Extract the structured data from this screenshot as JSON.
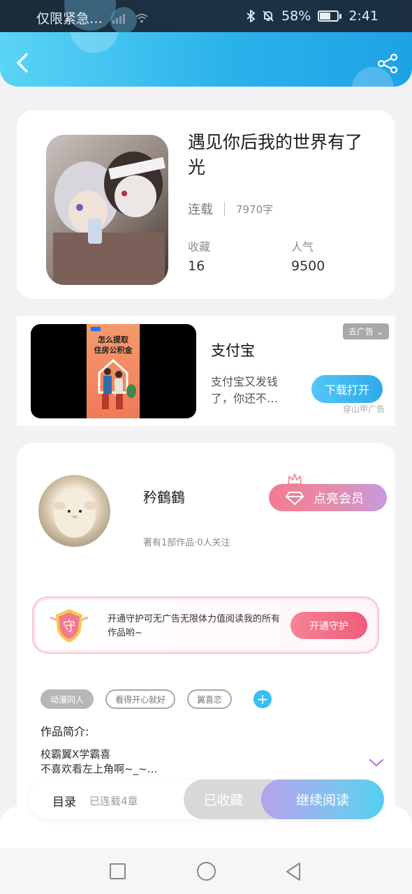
{
  "status_bar": {
    "carrier": "仅限紧急…",
    "battery": "58%",
    "time": "2:41"
  },
  "header": {
    "back_icon": "back-arrow-icon",
    "share_icon": "share-icon"
  },
  "book": {
    "title": "遇见你后我的世界有了光",
    "status": "连载",
    "word_count": "7970字",
    "favorites_label": "收藏",
    "favorites_value": "16",
    "popularity_label": "人气",
    "popularity_value": "9500"
  },
  "ad": {
    "close_label": "去广告",
    "title": "支付宝",
    "description": "支付宝又发钱了，你还不…",
    "button_label": "下载打开",
    "source": "穿山甲广告",
    "poster_text": "怎么提取住房公积金"
  },
  "author": {
    "name": "矜鶴鶴",
    "meta": "著有1部作品·0人关注",
    "vip_button": "点亮会员"
  },
  "guard": {
    "badge": "守",
    "text": "开通守护可无广告无限体力值阅读我的所有作品哟~",
    "button_label": "开通守护"
  },
  "tags": [
    "动漫同人",
    "看得开心就好",
    "翼喜恋"
  ],
  "intro": {
    "label": "作品简介:",
    "line1": "校霸翼X学霸喜",
    "line2": "不喜欢看左上角啊~_~…"
  },
  "actions": {
    "toc_label": "目录",
    "chapters": "已连载4章",
    "favorite_button": "已收藏",
    "read_button": "继续阅读"
  },
  "colors": {
    "header_gradient_start": "#5ad4f5",
    "header_gradient_end": "#1ea2e6",
    "accent_blue": "#37bff0",
    "vip_pink": "#f47b8e"
  }
}
